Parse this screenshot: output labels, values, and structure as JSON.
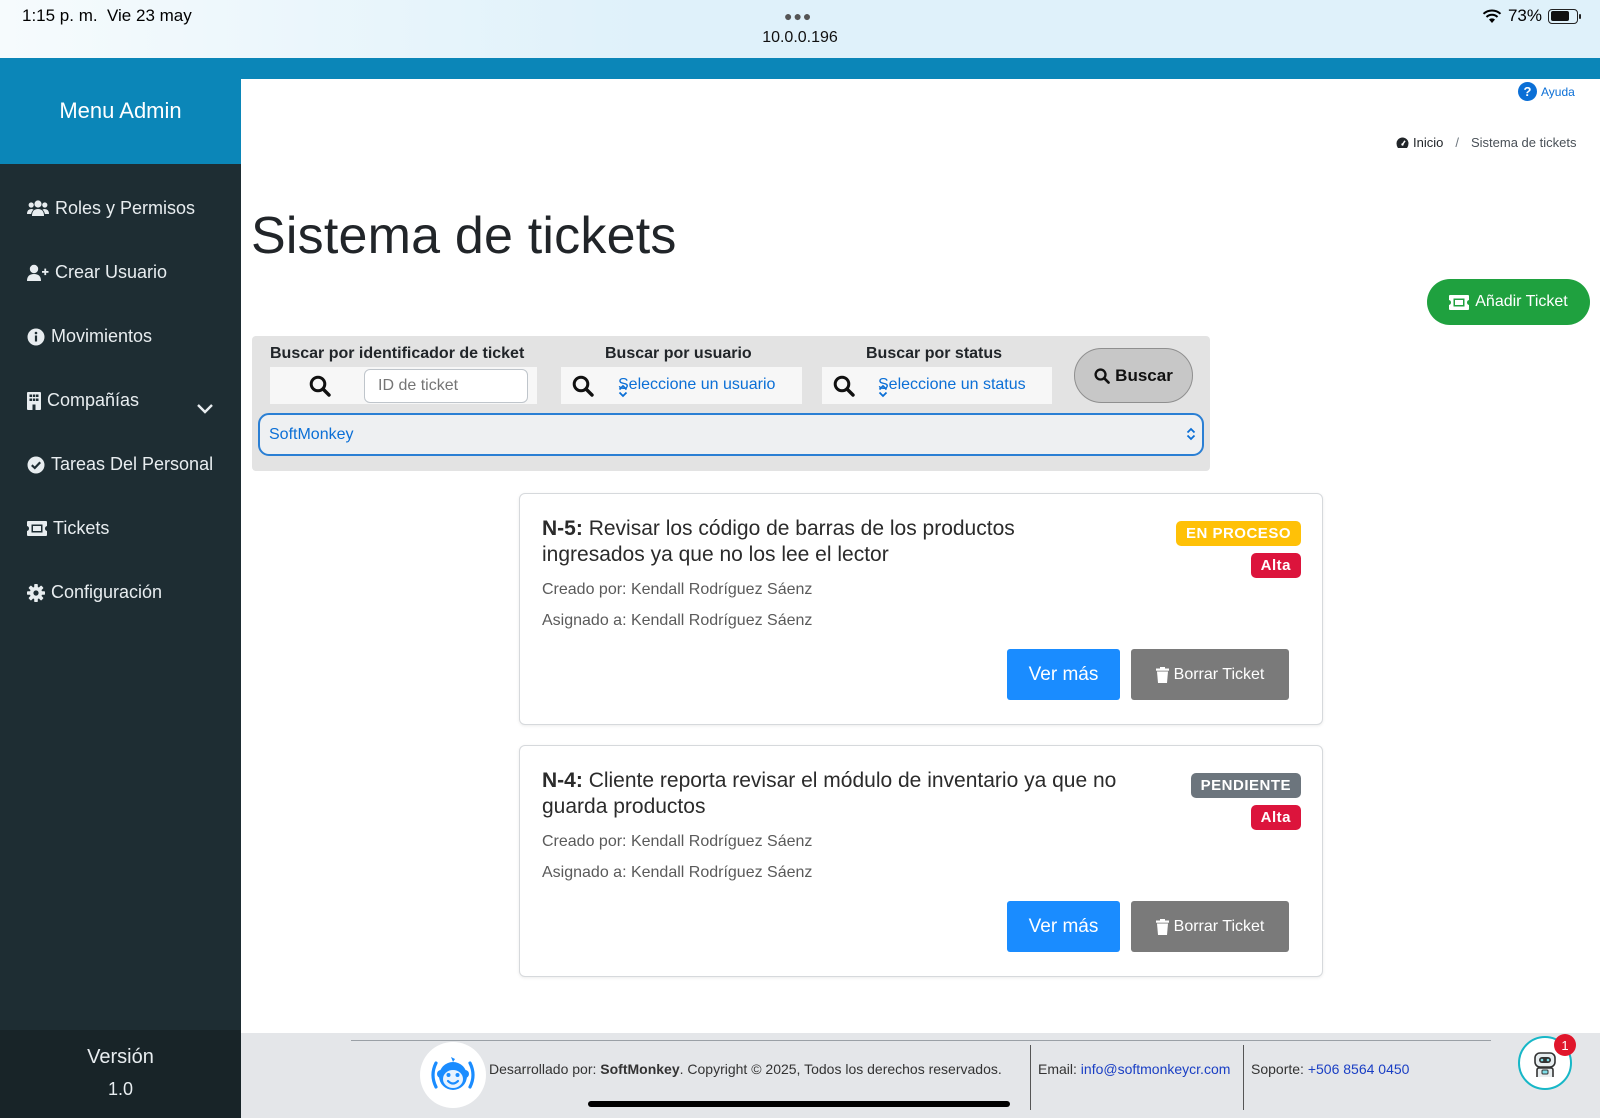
{
  "status_bar": {
    "time": "1:15 p. m.",
    "date": "Vie 23 may",
    "url": "10.0.0.196",
    "battery": "73%",
    "battery_level": 0.73
  },
  "sidebar": {
    "title": "Menu Admin",
    "items": [
      {
        "label": "Roles y Permisos",
        "icon": "users-icon"
      },
      {
        "label": "Crear Usuario",
        "icon": "user-plus-icon"
      },
      {
        "label": "Movimientos",
        "icon": "info-circle-icon"
      },
      {
        "label": "Compañías",
        "icon": "building-icon"
      },
      {
        "label": "Tareas Del Personal",
        "icon": "check-circle-icon"
      },
      {
        "label": "Tickets",
        "icon": "ticket-icon"
      },
      {
        "label": "Configuración",
        "icon": "gear-icon"
      }
    ],
    "footer_label": "Versión",
    "footer_version": "1.0"
  },
  "header": {
    "help_label": "Ayuda",
    "breadcrumb": {
      "home": "Inicio",
      "separator": "/",
      "current": "Sistema de tickets"
    },
    "page_title": "Sistema de tickets",
    "add_button": "Añadir Ticket"
  },
  "filters": {
    "id_label": "Buscar por identificador de ticket",
    "id_placeholder": "ID de ticket",
    "user_label": "Buscar por usuario",
    "user_value": "Seleccione un usuario",
    "status_label": "Buscar por status",
    "status_value": "Seleccione un status",
    "search_button": "Buscar",
    "company_value": "SoftMonkey"
  },
  "tickets": [
    {
      "code": "N-5",
      "title_line1": "Revisar los código de barras de los productos",
      "title_line2": "ingresados ya que no los lee el lector",
      "created_by": "Creado por: Kendall Rodríguez Sáenz",
      "assigned_to": "Asignado a: Kendall Rodríguez Sáenz",
      "status": "EN PROCESO",
      "priority": "Alta",
      "view_button": "Ver más",
      "delete_button": "Borrar Ticket"
    },
    {
      "code": "N-4",
      "title_line1": "Cliente reporta revisar el módulo de inventario ya que no",
      "title_line2": "guarda productos",
      "created_by": "Creado por: Kendall Rodríguez Sáenz",
      "assigned_to": "Asignado a: Kendall Rodríguez Sáenz",
      "status": "PENDIENTE",
      "priority": "Alta",
      "view_button": "Ver más",
      "delete_button": "Borrar Ticket"
    }
  ],
  "footer": {
    "dev_prefix": "Desarrollado por: ",
    "dev_name": "SoftMonkey",
    "dev_suffix": ". Copyright © 2025, Todos los derechos reservados.",
    "email_label": "Email: ",
    "email": "info@softmonkeycr.com",
    "support_label": "Soporte: ",
    "phone": "+506 8564 0450",
    "chat_badge": "1"
  },
  "colors": {
    "sidebar_bg": "#1e2d33",
    "accent_blue": "#0b86b8",
    "success_green": "#1fa13f",
    "status_in_progress": "#ffc107",
    "status_pending": "#6c757d",
    "priority_high": "#dc143c",
    "primary_button": "#1a8cff"
  }
}
